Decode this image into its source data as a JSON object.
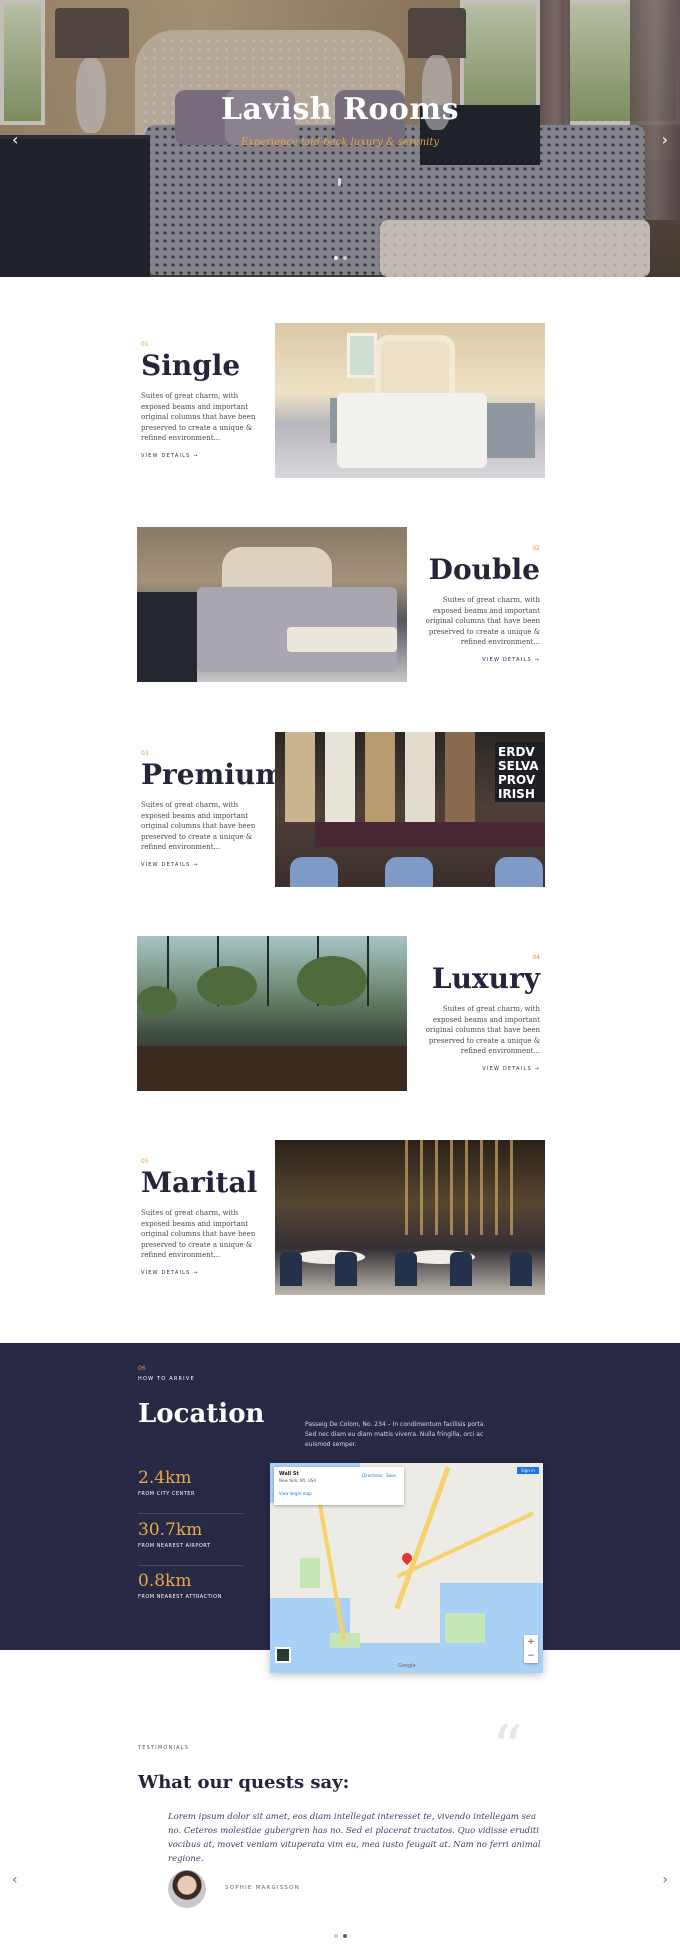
{
  "hero": {
    "title": "Lavish Rooms",
    "subtitle": "Experience laid-back luxury & serenity",
    "prev_icon": "chevron-left-icon",
    "next_icon": "chevron-right-icon",
    "prev_glyph": "‹",
    "next_glyph": "›",
    "slide_count": 2,
    "active_slide": 1
  },
  "rooms": [
    {
      "num": "01",
      "name": "Single",
      "desc": "Suites of great charm, with exposed beams and important original columns that have been preserved to create a unique & refined environment...",
      "link": "VIEW DETAILS →"
    },
    {
      "num": "02",
      "name": "Double",
      "desc": "Suites of great charm, with exposed beams and important original columns that have been preserved to create a unique & refined environment...",
      "link": "VIEW DETAILS →"
    },
    {
      "num": "03",
      "name": "Premium",
      "desc": "Suites of great charm, with exposed beams and important original columns that have been preserved to create a unique & refined environment...",
      "link": "VIEW DETAILS →",
      "board_text": "ERDV SELVA PROV IRISH"
    },
    {
      "num": "04",
      "name": "Luxury",
      "desc": "Suites of great charm, with exposed beams and important original columns that have been preserved to create a unique & refined environment...",
      "link": "VIEW DETAILS →"
    },
    {
      "num": "05",
      "name": "Marital",
      "desc": "Suites of great charm, with exposed beams and important original columns that have been preserved to create a unique & refined environment...",
      "link": "VIEW DETAILS →"
    }
  ],
  "location": {
    "num": "06",
    "kicker": "HOW TO ARRIVE",
    "title": "Location",
    "text": "Passeig De Colom, No. 234 – In condimentum facilisis porta. Sed nec diam eu diam mattis viverra. Nulla fringilla, orci ac euismod semper.",
    "stats": [
      {
        "value": "2.4km",
        "label": "FROM CITY CENTER"
      },
      {
        "value": "30.7km",
        "label": "FROM NEAREST AIRPORT"
      },
      {
        "value": "0.8km",
        "label": "FROM NEAREST ATTRACTION"
      }
    ],
    "map": {
      "place": "Wall St",
      "address": "New York, NY, USA",
      "larger_map": "View larger map",
      "directions": "Directions",
      "save": "Save",
      "expand": "Sign in",
      "zoom_in": "+",
      "zoom_out": "−",
      "google": "Google",
      "marker_icon": "map-pin-icon"
    }
  },
  "testimonials": {
    "kicker": "TESTIMONIALS",
    "quote_mark": "“",
    "title": "What our quests say:",
    "text": "Lorem ipsum dolor sit amet, eos diam intellegat interesset te, vivendo intellegam sea no. Ceteros molestiae gubergren has no. Sed ei placerat tractatos. Quo vidisse eruditi vocibus at, movet veniam vituperata vim eu, mea iusto feugait at. Nam no ferri animal regione.",
    "author": "SOPHIE MARGISSON",
    "prev_glyph": "‹",
    "next_glyph": "›",
    "slide_count": 2,
    "active_slide": 2
  },
  "colors": {
    "accent": "#e2993a",
    "navy": "#272945",
    "text_dark": "#25253a"
  }
}
